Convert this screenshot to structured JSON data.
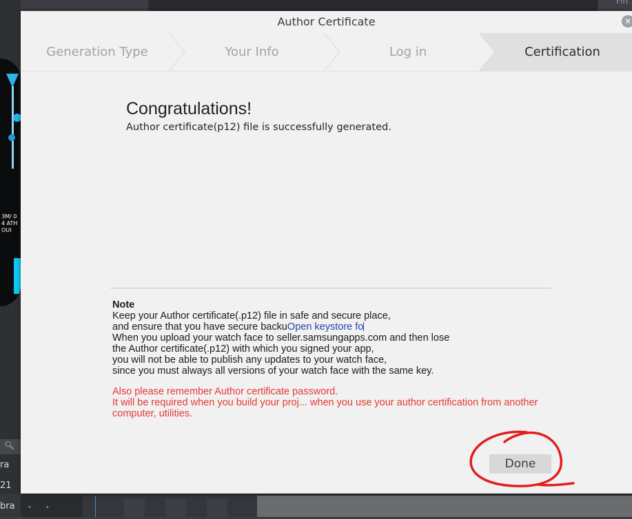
{
  "background": {
    "top_right_text": "Fin",
    "watch_text": "3M/ 0 4 ATH  OUI",
    "search_icon": "magnifier-icon",
    "list_rows": [
      "ra",
      "21",
      "bra"
    ]
  },
  "dialog": {
    "title": "Author Certificate",
    "close_icon": "close-icon",
    "steps": [
      {
        "label": "Generation Type",
        "state": "inactive"
      },
      {
        "label": "Your Info",
        "state": "inactive"
      },
      {
        "label": "Log in",
        "state": "inactive"
      },
      {
        "label": "Certification",
        "state": "active"
      }
    ],
    "congrats_title": "Congratulations!",
    "congrats_subtitle": "Author certificate(p12) file is successfully generated.",
    "note": {
      "heading": "Note",
      "line1": "Keep your Author certificate(.p12) file in safe and secure place,",
      "line2_prefix": "and ensure that you have secure backu",
      "line2_link": "Open keystore fo",
      "line3": "When you upload your watch face to seller.samsungapps.com and then lose",
      "line4": "the Author certificate(.p12) with which you signed your app,",
      "line5": "you will not be able to publish any updates to your watch face,",
      "line6": "since you must always all versions of your watch face with the same key.",
      "warning1": "Also please remember Author certificate password.",
      "warning2": "It will be required when you build your proj... when you use your author certification from another computer, utilities."
    },
    "done_label": "Done"
  },
  "colors": {
    "dialog_bg": "#f1f1f1",
    "active_step_bg": "#e0e0e0",
    "link": "#2646a8",
    "warning": "#e53935",
    "annotation": "#e01e1e"
  }
}
